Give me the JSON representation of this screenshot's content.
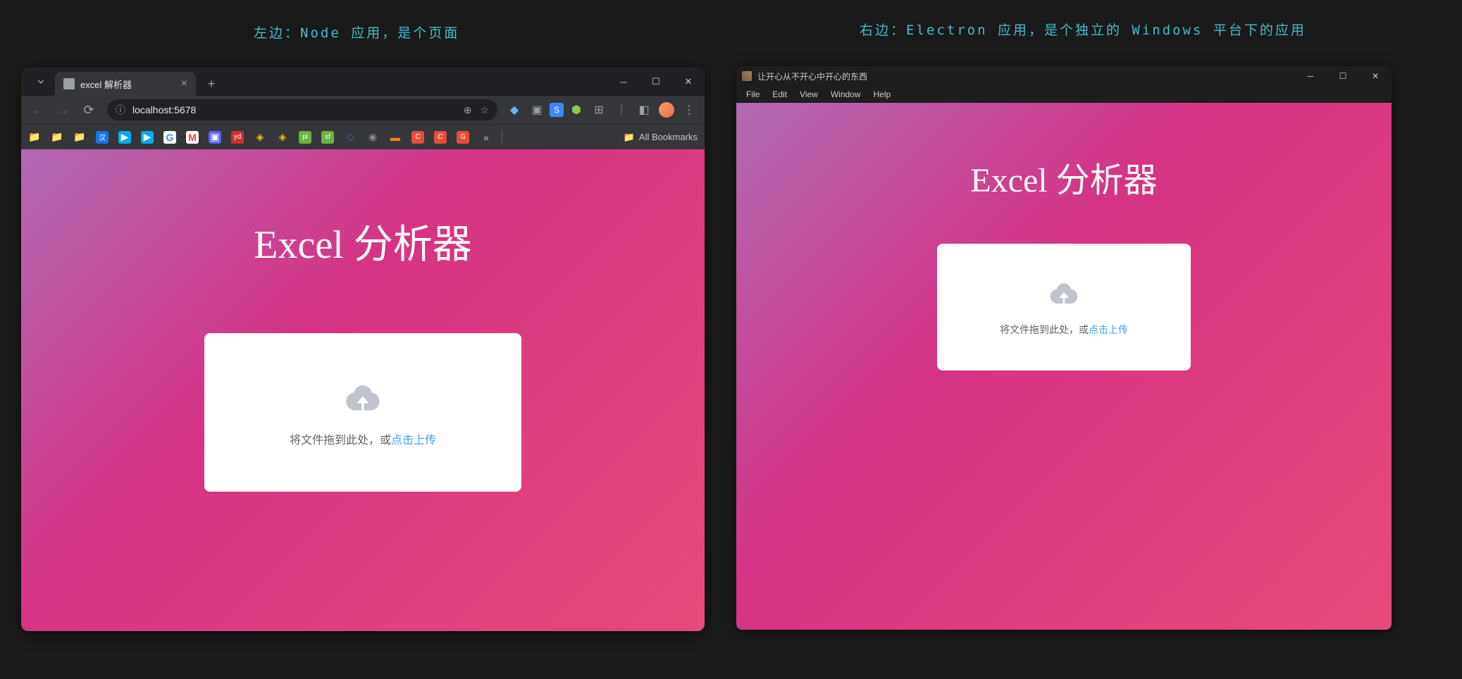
{
  "captions": {
    "left": "左边：Node 应用，是个页面",
    "right": "右边：Electron 应用，是个独立的 Windows 平台下的应用"
  },
  "chrome": {
    "tab_title": "excel 解析器",
    "address": "localhost:5678",
    "all_bookmarks_label": "All Bookmarks"
  },
  "electron": {
    "window_title": "让开心从不开心中开心的东西",
    "menu": [
      "File",
      "Edit",
      "View",
      "Window",
      "Help"
    ]
  },
  "app": {
    "title": "Excel 分析器",
    "upload_text_prefix": "将文件拖到此处，或",
    "upload_link": "点击上传"
  }
}
